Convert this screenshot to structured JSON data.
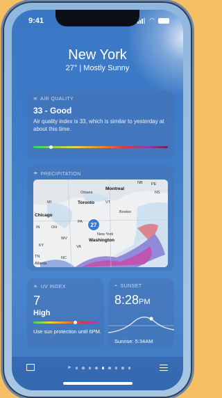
{
  "status_bar": {
    "time": "9:41"
  },
  "header": {
    "city": "New York",
    "subtitle": "27° | Mostly Sunny"
  },
  "air_quality": {
    "heading": "AIR QUALITY",
    "value": "33 - Good",
    "description": "Air quality index is 33, which is similar to yesterday at about this time.",
    "scale_position": 0.12
  },
  "precipitation": {
    "heading": "PRECIPITATION",
    "pin_temp": "27",
    "map_labels": {
      "ottawa": "Ottawa",
      "montreal": "Montreal",
      "nb": "NB",
      "pe": "PE",
      "ns": "NS",
      "toronto": "Toronto",
      "vt": "VT",
      "mi": "MI",
      "chicago": "Chicago",
      "boston": "Boston",
      "in": "IN",
      "oh": "OH",
      "pa": "PA",
      "newyork": "New York",
      "washington": "Washington",
      "ky": "KY",
      "wv": "WV",
      "va": "VA",
      "tn": "TN",
      "nc": "NC",
      "atlanta": "Atlanta"
    }
  },
  "uv_index": {
    "heading": "UV INDEX",
    "value": "7",
    "level": "High",
    "advice": "Use sun protection until 6PM.",
    "scale_position": 0.62
  },
  "sunset": {
    "heading": "SUNSET",
    "time": "8:28",
    "period": "PM",
    "sunrise": "Sunrise: 5:34AM"
  },
  "colors": {
    "background": "#f6bf63",
    "sky": "#3a78c6"
  }
}
